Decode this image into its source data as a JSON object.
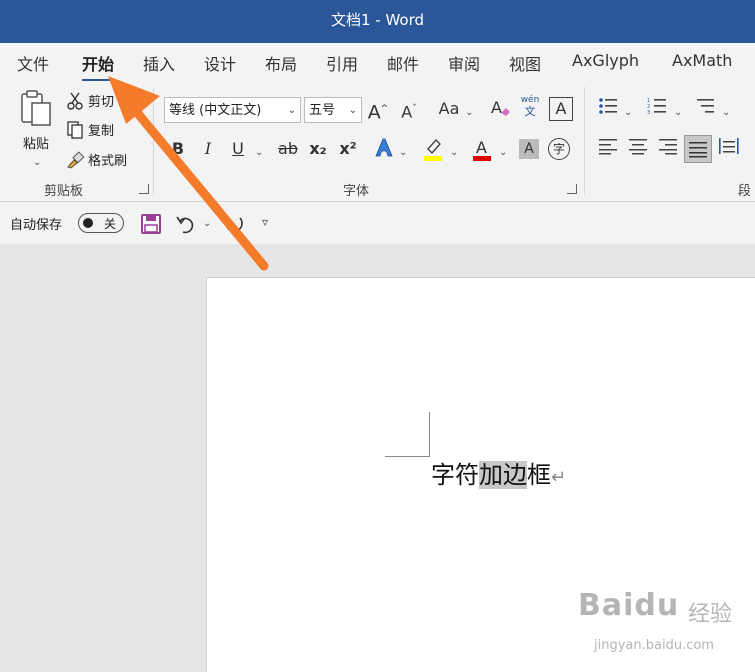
{
  "title": "文档1  -  Word",
  "menu": [
    "文件",
    "开始",
    "插入",
    "设计",
    "布局",
    "引用",
    "邮件",
    "审阅",
    "视图",
    "AxGlyph",
    "AxMath"
  ],
  "clipboard": {
    "paste": "粘贴",
    "cut": "剪切",
    "copy": "复制",
    "format_painter": "格式刷",
    "group_label": "剪贴板"
  },
  "font": {
    "name": "等线 (中文正文)",
    "size": "五号",
    "group_label": "字体",
    "bold": "B",
    "italic": "I",
    "underline": "U",
    "strike": "ab",
    "subscript": "x₂",
    "superscript": "x²",
    "grow": "A",
    "shrink": "A",
    "change_case": "Aa",
    "phonetic_top": "wén",
    "phonetic_bottom": "文",
    "border_char": "A",
    "shade_char": "A",
    "enclose_char": "字"
  },
  "paragraph": {
    "group_label": "段"
  },
  "qat": {
    "autosave_label": "自动保存",
    "autosave_state": "关"
  },
  "document": {
    "text_before": "字符",
    "text_highlight": "加边",
    "text_after": "框",
    "para_mark": "↵"
  },
  "watermark": {
    "brand": "Baidu",
    "brand_cn": "经验",
    "url": "jingyan.baidu.com"
  },
  "colors": {
    "title_bar": "#2b579a",
    "arrow": "#f47b2a",
    "highlight_yellow": "#ffff00",
    "font_red": "#e00000"
  }
}
